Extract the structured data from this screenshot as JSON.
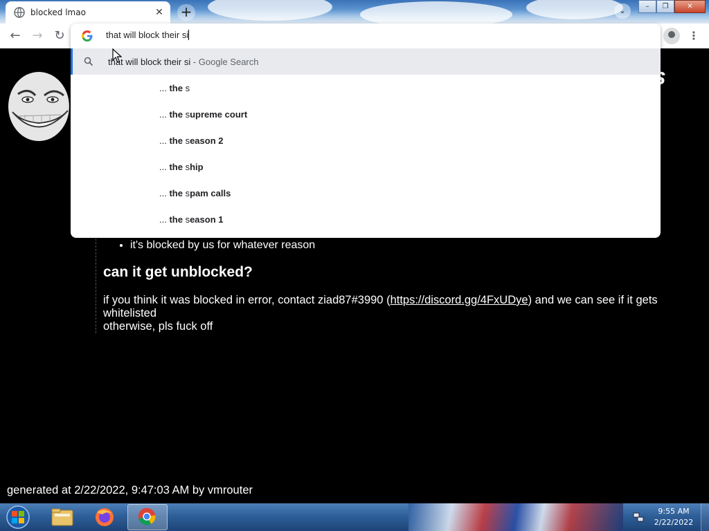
{
  "browser": {
    "tab": {
      "title": "blocked lmao"
    },
    "new_tab_label": "+",
    "tab_search_label": "⌄",
    "window_buttons": {
      "minimize": "–",
      "maximize": "❐",
      "close": "✕"
    }
  },
  "toolbar": {
    "back": "←",
    "forward": "→",
    "reload": "↻",
    "menu": "⋮"
  },
  "omnibox": {
    "input_value": "that will block their si",
    "selected_suggestion": {
      "text": "that will block their si",
      "suffix": " - Google Search"
    },
    "suggestions": [
      {
        "prefix": "... ",
        "bold1": "the ",
        "plain": "s",
        "bold2": ""
      },
      {
        "prefix": "... ",
        "bold1": "the ",
        "plain": "s",
        "bold2": "upreme court"
      },
      {
        "prefix": "... ",
        "bold1": "the ",
        "plain": "s",
        "bold2": "eason 2"
      },
      {
        "prefix": "... ",
        "bold1": "the ",
        "plain": "s",
        "bold2": "hip"
      },
      {
        "prefix": "... ",
        "bold1": "the ",
        "plain": "s",
        "bold2": "pam calls"
      },
      {
        "prefix": "... ",
        "bold1": "the ",
        "plain": "s",
        "bold2": "eason 1"
      }
    ]
  },
  "page": {
    "heading_fragment": "vs",
    "bullets": [
      "it's blocked by us for whatever reason"
    ],
    "unblock_heading": "can it get unblocked?",
    "paragraph": {
      "before_link": "if you think it was blocked in error, contact ziad87#3990 (",
      "link": "https://discord.gg/4FxUDye",
      "after_link": ") and we can see if it gets whitelisted",
      "line2": "otherwise, pls fuck off"
    },
    "footer": "generated at 2/22/2022, 9:47:03 AM by vmrouter"
  },
  "taskbar": {
    "clock_time": "9:55 AM",
    "clock_date": "2/22/2022",
    "items": [
      "windows-explorer",
      "firefox",
      "chrome"
    ]
  },
  "colors": {
    "accent": "#1a73e8",
    "page_bg": "#000000",
    "page_text": "#ffffff",
    "omnibox_selected_bg": "#e8eaed"
  }
}
